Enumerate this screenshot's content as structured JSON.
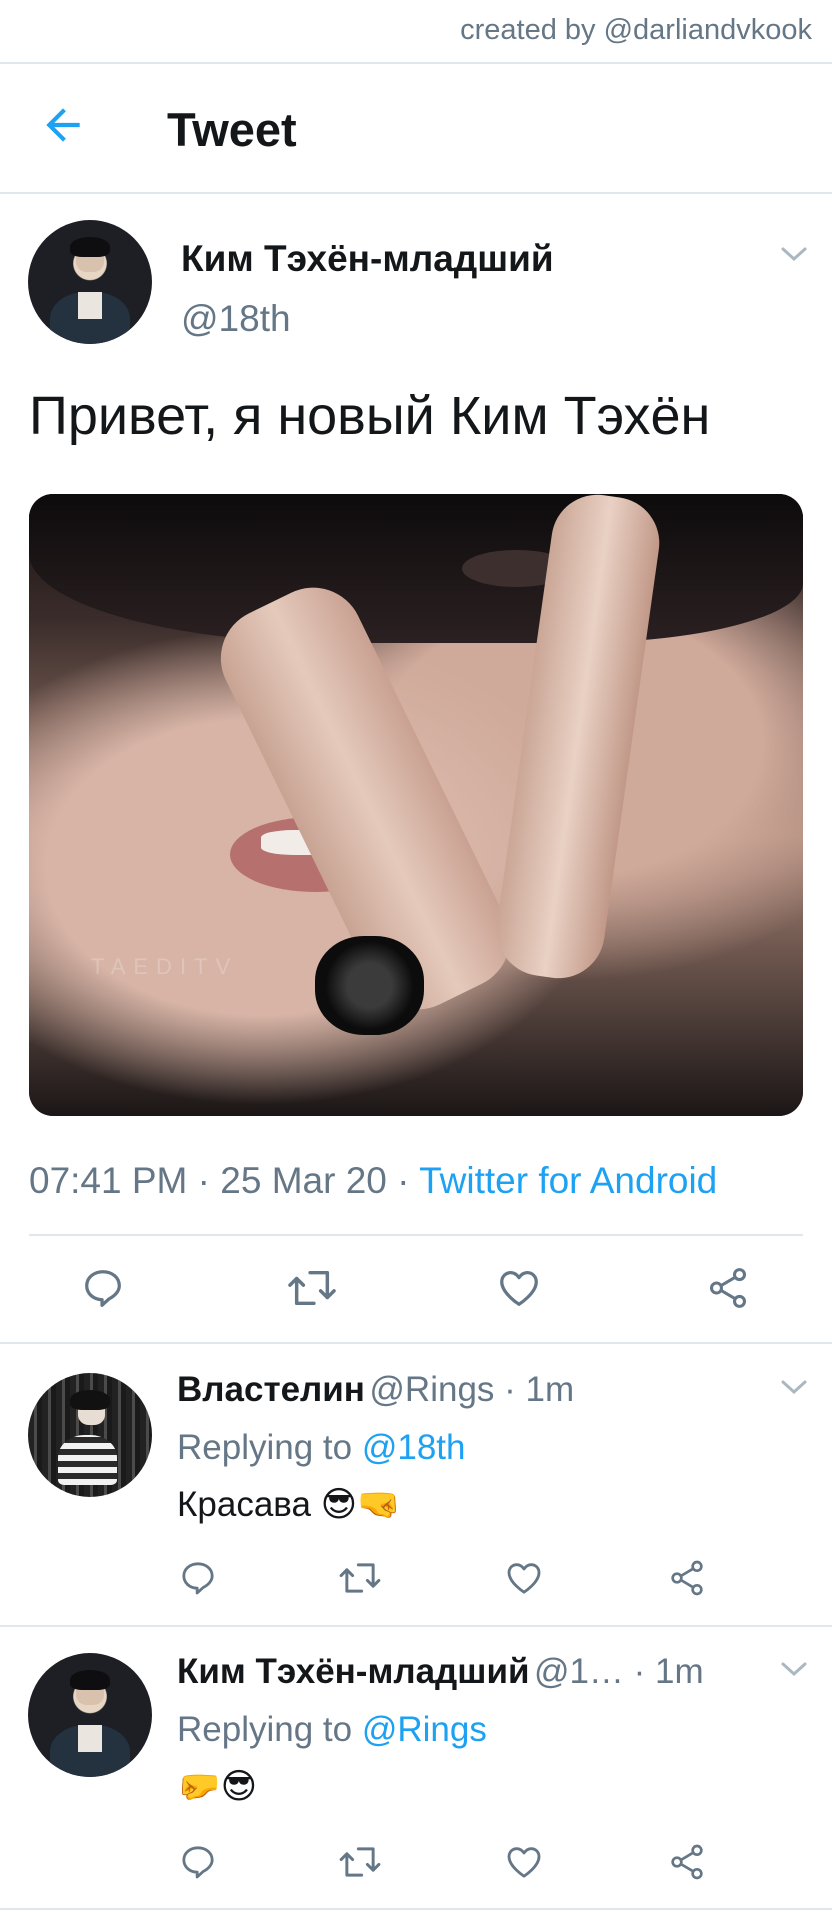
{
  "credit": "created by @darliandvkook",
  "header": {
    "title": "Tweet"
  },
  "tweet": {
    "name": "Ким Тэхён-младший",
    "handle": "@18th",
    "text": "Привет, я новый Ким Тэхён",
    "media_watermark": "TAEDITV",
    "time": "07:41 PM",
    "sep1": " · ",
    "date": "25 Mar 20",
    "sep2": " · ",
    "source": "Twitter for Android"
  },
  "replies": [
    {
      "name": "Властелин",
      "handle": "@Rings",
      "time": " · 1m",
      "replying_prefix": "Replying to ",
      "replying_to": "@18th",
      "text": "Красава 😎🤜"
    },
    {
      "name": "Ким Тэхён-младший",
      "handle": "@1…",
      "time": " · 1m",
      "replying_prefix": "Replying to ",
      "replying_to": "@Rings",
      "text": "🤛😎"
    }
  ],
  "icons": {
    "back": "arrow-left-icon",
    "reply": "reply-icon",
    "retweet": "retweet-icon",
    "like": "heart-icon",
    "share": "share-icon",
    "chevron": "chevron-down-icon"
  },
  "colors": {
    "accent": "#1da1f2",
    "text": "#14171a",
    "secondary": "#657786",
    "divider": "#e1e8ed"
  }
}
